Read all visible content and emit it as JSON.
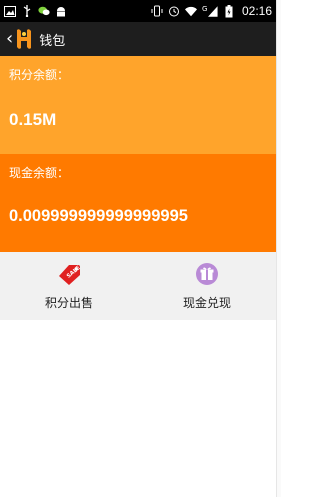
{
  "status_bar": {
    "time": "02:16",
    "signal_label": "G",
    "icons": [
      "image-icon",
      "usb-icon",
      "wechat-icon",
      "android-icon",
      "vibrate-icon",
      "alarm-icon",
      "wifi-icon",
      "signal-icon",
      "battery-icon"
    ]
  },
  "app_bar": {
    "title": "钱包",
    "back_icon": "chevron-left-icon",
    "logo": "app-logo-icon"
  },
  "points_card": {
    "label": "积分余额：",
    "value": "0.15M",
    "color": "#ffa42b"
  },
  "cash_card": {
    "label": "现金余额：",
    "value": "0.009999999999999995",
    "color": "#ff7a00"
  },
  "actions": [
    {
      "label": "积分出售",
      "icon": "sale-tag-icon",
      "color": "#e02020"
    },
    {
      "label": "现金兑现",
      "icon": "gift-icon",
      "color": "#b98ad6"
    }
  ]
}
